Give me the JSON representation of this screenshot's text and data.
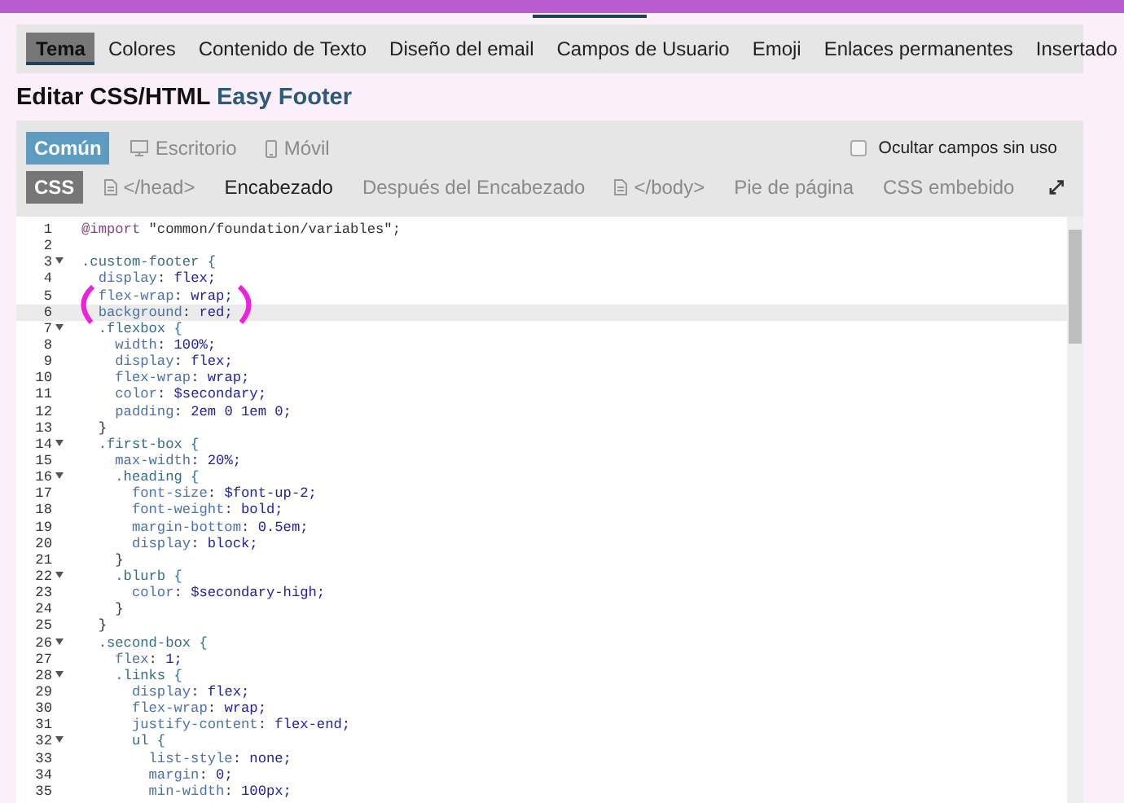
{
  "tabs": [
    {
      "label": "Tema",
      "selected": true
    },
    {
      "label": "Colores",
      "selected": false
    },
    {
      "label": "Contenido de Texto",
      "selected": false
    },
    {
      "label": "Diseño del email",
      "selected": false
    },
    {
      "label": "Campos de Usuario",
      "selected": false
    },
    {
      "label": "Emoji",
      "selected": false
    },
    {
      "label": "Enlaces permanentes",
      "selected": false
    },
    {
      "label": "Insertado",
      "selected": false
    }
  ],
  "heading": {
    "prefix": "Editar CSS/HTML",
    "name": "Easy Footer"
  },
  "targets": [
    {
      "label": "Común",
      "kind": "plain",
      "selected": true
    },
    {
      "label": "Escritorio",
      "kind": "desktop",
      "selected": false
    },
    {
      "label": "Móvil",
      "kind": "mobile",
      "selected": false
    }
  ],
  "hide_unused": {
    "label": "Ocultar campos sin uso",
    "checked": false
  },
  "fields": [
    {
      "label": "CSS",
      "kind": "plain",
      "selected": true,
      "has_content": true
    },
    {
      "label": "</head>",
      "kind": "file",
      "selected": false,
      "has_content": false
    },
    {
      "label": "Encabezado",
      "kind": "plain",
      "selected": false,
      "has_content": true
    },
    {
      "label": "Después del Encabezado",
      "kind": "plain",
      "selected": false,
      "has_content": false
    },
    {
      "label": "</body>",
      "kind": "file",
      "selected": false,
      "has_content": false
    },
    {
      "label": "Pie de página",
      "kind": "plain",
      "selected": false,
      "has_content": false
    },
    {
      "label": "CSS embebido",
      "kind": "plain",
      "selected": false,
      "has_content": false
    }
  ],
  "code_lines": [
    {
      "number": "1",
      "text": "@import \"common/foundation/variables\";",
      "fold": false,
      "highlighted": false
    },
    {
      "number": "2",
      "fold": false,
      "highlighted": false
    },
    {
      "number": "3",
      "text": ".custom-footer {",
      "fold": true,
      "highlighted": false
    },
    {
      "number": "4",
      "text": "  display: flex;",
      "fold": false,
      "highlighted": false
    },
    {
      "number": "5",
      "text": "  flex-wrap: wrap;",
      "fold": false,
      "highlighted": false
    },
    {
      "number": "6",
      "text": "  background: red;",
      "fold": false,
      "highlighted": true
    },
    {
      "number": "7",
      "text": "  .flexbox {",
      "fold": true,
      "highlighted": false
    },
    {
      "number": "8",
      "text": "    width: 100%;",
      "fold": false,
      "highlighted": false
    },
    {
      "number": "9",
      "text": "    display: flex;",
      "fold": false,
      "highlighted": false
    },
    {
      "number": "10",
      "text": "    flex-wrap: wrap;",
      "fold": false,
      "highlighted": false
    },
    {
      "number": "11",
      "text": "    color: $secondary;",
      "fold": false,
      "highlighted": false
    },
    {
      "number": "12",
      "text": "    padding: 2em 0 1em 0;",
      "fold": false,
      "highlighted": false
    },
    {
      "number": "13",
      "text": "  }",
      "fold": false,
      "highlighted": false
    },
    {
      "number": "14",
      "text": "  .first-box {",
      "fold": true,
      "highlighted": false
    },
    {
      "number": "15",
      "text": "    max-width: 20%;",
      "fold": false,
      "highlighted": false
    },
    {
      "number": "16",
      "text": "    .heading {",
      "fold": true,
      "highlighted": false
    },
    {
      "number": "17",
      "text": "      font-size: $font-up-2;",
      "fold": false,
      "highlighted": false
    },
    {
      "number": "18",
      "text": "      font-weight: bold;",
      "fold": false,
      "highlighted": false
    },
    {
      "number": "19",
      "text": "      margin-bottom: 0.5em;",
      "fold": false,
      "highlighted": false
    },
    {
      "number": "20",
      "text": "      display: block;",
      "fold": false,
      "highlighted": false
    },
    {
      "number": "21",
      "text": "    }",
      "fold": false,
      "highlighted": false
    },
    {
      "number": "22",
      "text": "    .blurb {",
      "fold": true,
      "highlighted": false
    },
    {
      "number": "23",
      "text": "      color: $secondary-high;",
      "fold": false,
      "highlighted": false
    },
    {
      "number": "24",
      "text": "    }",
      "fold": false,
      "highlighted": false
    },
    {
      "number": "25",
      "text": "  }",
      "fold": false,
      "highlighted": false
    },
    {
      "number": "26",
      "text": "  .second-box {",
      "fold": true,
      "highlighted": false
    },
    {
      "number": "27",
      "text": "    flex: 1;",
      "fold": false,
      "highlighted": false
    },
    {
      "number": "28",
      "text": "    .links {",
      "fold": true,
      "highlighted": false
    },
    {
      "number": "29",
      "text": "      display: flex;",
      "fold": false,
      "highlighted": false
    },
    {
      "number": "30",
      "text": "      flex-wrap: wrap;",
      "fold": false,
      "highlighted": false
    },
    {
      "number": "31",
      "text": "      justify-content: flex-end;",
      "fold": false,
      "highlighted": false
    },
    {
      "number": "32",
      "text": "      ul {",
      "fold": true,
      "highlighted": false
    },
    {
      "number": "33",
      "text": "        list-style: none;",
      "fold": false,
      "highlighted": false
    },
    {
      "number": "34",
      "text": "        margin: 0;",
      "fold": false,
      "highlighted": false
    },
    {
      "number": "35",
      "text": "        min-width: 100px;",
      "fold": false,
      "highlighted": false
    }
  ]
}
